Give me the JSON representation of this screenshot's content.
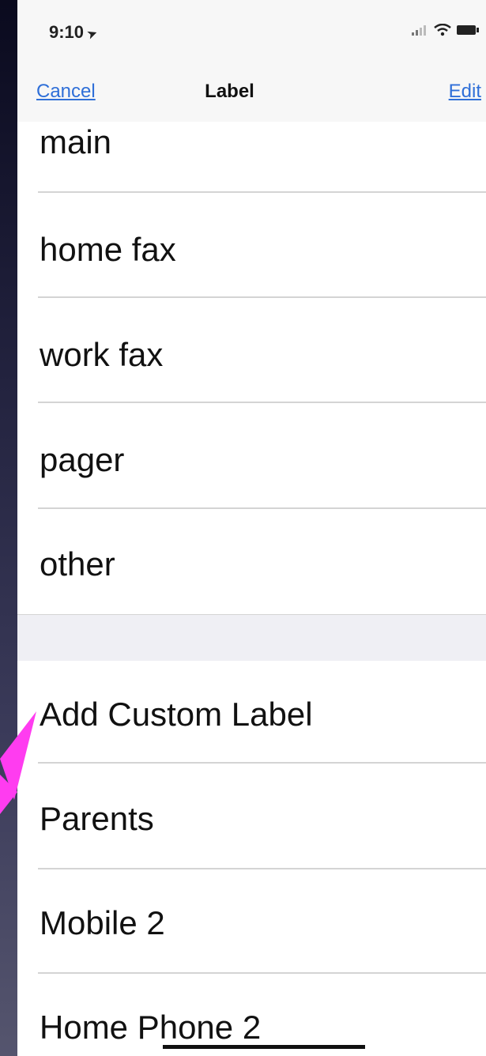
{
  "status_bar": {
    "time": "9:10",
    "icons": [
      "location-arrow-icon",
      "signal-icon",
      "wifi-icon",
      "battery-icon"
    ]
  },
  "nav": {
    "cancel_label": "Cancel",
    "title": "Label",
    "edit_label": "Edit"
  },
  "labels": {
    "main": "main",
    "home_fax": "home fax",
    "work_fax": "work fax",
    "pager": "pager",
    "other": "other"
  },
  "custom": {
    "add_label": "Add Custom Label",
    "parents": "Parents",
    "mobile_2": "Mobile 2",
    "home_phone_2": "Home Phone 2"
  },
  "colors": {
    "accent": "#2f6fd8",
    "arrow": "#ff3cf0"
  }
}
